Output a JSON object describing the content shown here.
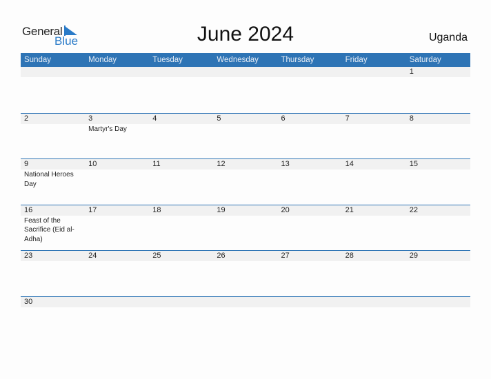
{
  "logo": {
    "general": "General",
    "blue": "Blue"
  },
  "title": "June 2024",
  "country": "Uganda",
  "colors": {
    "accent": "#2e74b5",
    "logo_blue": "#2a7bc8",
    "day_strip": "#f1f1f1"
  },
  "weekdays": [
    "Sunday",
    "Monday",
    "Tuesday",
    "Wednesday",
    "Thursday",
    "Friday",
    "Saturday"
  ],
  "weeks": [
    [
      {
        "day": ""
      },
      {
        "day": ""
      },
      {
        "day": ""
      },
      {
        "day": ""
      },
      {
        "day": ""
      },
      {
        "day": ""
      },
      {
        "day": "1"
      }
    ],
    [
      {
        "day": "2"
      },
      {
        "day": "3",
        "event": "Martyr's Day"
      },
      {
        "day": "4"
      },
      {
        "day": "5"
      },
      {
        "day": "6"
      },
      {
        "day": "7"
      },
      {
        "day": "8"
      }
    ],
    [
      {
        "day": "9",
        "event": "National Heroes Day"
      },
      {
        "day": "10"
      },
      {
        "day": "11"
      },
      {
        "day": "12"
      },
      {
        "day": "13"
      },
      {
        "day": "14"
      },
      {
        "day": "15"
      }
    ],
    [
      {
        "day": "16",
        "event": "Feast of the Sacrifice (Eid al-Adha)"
      },
      {
        "day": "17"
      },
      {
        "day": "18"
      },
      {
        "day": "19"
      },
      {
        "day": "20"
      },
      {
        "day": "21"
      },
      {
        "day": "22"
      }
    ],
    [
      {
        "day": "23"
      },
      {
        "day": "24"
      },
      {
        "day": "25"
      },
      {
        "day": "26"
      },
      {
        "day": "27"
      },
      {
        "day": "28"
      },
      {
        "day": "29"
      }
    ],
    [
      {
        "day": "30"
      },
      {
        "day": ""
      },
      {
        "day": ""
      },
      {
        "day": ""
      },
      {
        "day": ""
      },
      {
        "day": ""
      },
      {
        "day": ""
      }
    ]
  ]
}
